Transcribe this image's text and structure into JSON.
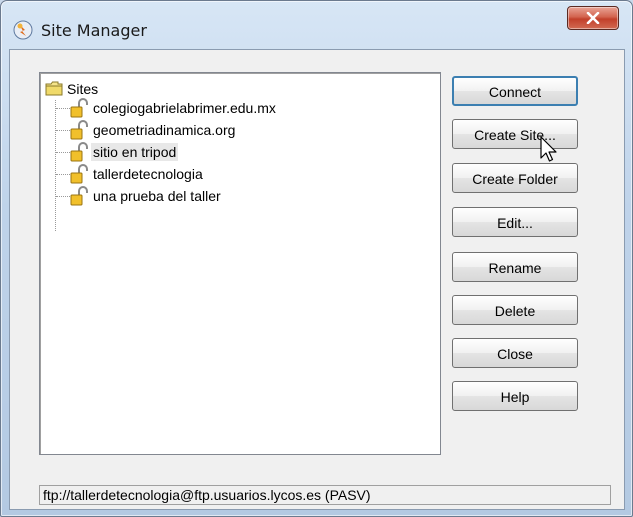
{
  "window": {
    "title": "Site Manager"
  },
  "tree": {
    "root_label": "Sites",
    "sites": [
      {
        "label": "colegiogabrielabrimer.edu.mx",
        "selected": false
      },
      {
        "label": "geometriadinamica.org",
        "selected": false
      },
      {
        "label": "sitio en tripod",
        "selected": true
      },
      {
        "label": "tallerdetecnologia",
        "selected": false
      },
      {
        "label": "una prueba del taller",
        "selected": false
      }
    ]
  },
  "buttons": {
    "connect": "Connect",
    "create_site": "Create Site...",
    "create_folder": "Create Folder",
    "edit": "Edit...",
    "rename": "Rename",
    "delete": "Delete",
    "close": "Close",
    "help": "Help"
  },
  "status": {
    "text": "ftp://tallerdetecnologia@ftp.usuarios.lycos.es (PASV)"
  },
  "icons": {
    "app": "site-manager-app-icon",
    "root": "folder-icon",
    "site": "lock-icon",
    "close": "close-icon",
    "cursor": "mouse-cursor-icon"
  },
  "colors": {
    "close_button": "#c94a35",
    "default_button_border": "#3c7fb1"
  }
}
